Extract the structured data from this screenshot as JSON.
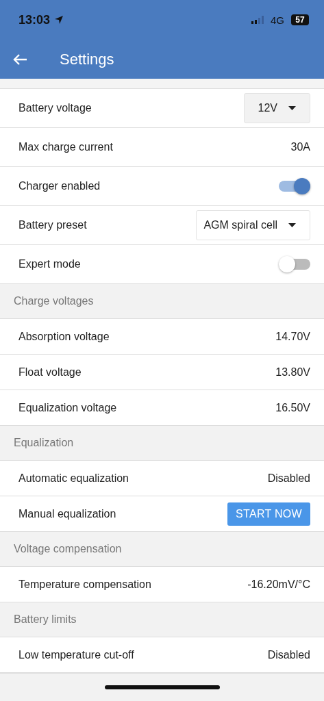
{
  "status_bar": {
    "time": "13:03",
    "network": "4G",
    "battery": "57"
  },
  "app_bar": {
    "title": "Settings"
  },
  "sections": [
    {
      "rows": [
        {
          "kind": "select",
          "label": "Battery voltage",
          "value": "12V"
        },
        {
          "kind": "value",
          "label": "Max charge current",
          "value": "30A"
        },
        {
          "kind": "toggle",
          "label": "Charger enabled",
          "on": true
        },
        {
          "kind": "select",
          "label": "Battery preset",
          "value": "AGM spiral cell"
        },
        {
          "kind": "toggle",
          "label": "Expert mode",
          "on": false
        }
      ]
    },
    {
      "header": "Charge voltages",
      "rows": [
        {
          "kind": "value",
          "label": "Absorption voltage",
          "value": "14.70V"
        },
        {
          "kind": "value",
          "label": "Float voltage",
          "value": "13.80V"
        },
        {
          "kind": "value",
          "label": "Equalization voltage",
          "value": "16.50V"
        }
      ]
    },
    {
      "header": "Equalization",
      "rows": [
        {
          "kind": "value",
          "label": "Automatic equalization",
          "value": "Disabled"
        },
        {
          "kind": "button",
          "label": "Manual equalization",
          "value": "START NOW"
        }
      ]
    },
    {
      "header": "Voltage compensation",
      "rows": [
        {
          "kind": "value",
          "label": "Temperature compensation",
          "value": "-16.20mV/°C"
        }
      ]
    },
    {
      "header": "Battery limits",
      "rows": [
        {
          "kind": "value",
          "label": "Low temperature cut-off",
          "value": "Disabled"
        }
      ]
    }
  ]
}
